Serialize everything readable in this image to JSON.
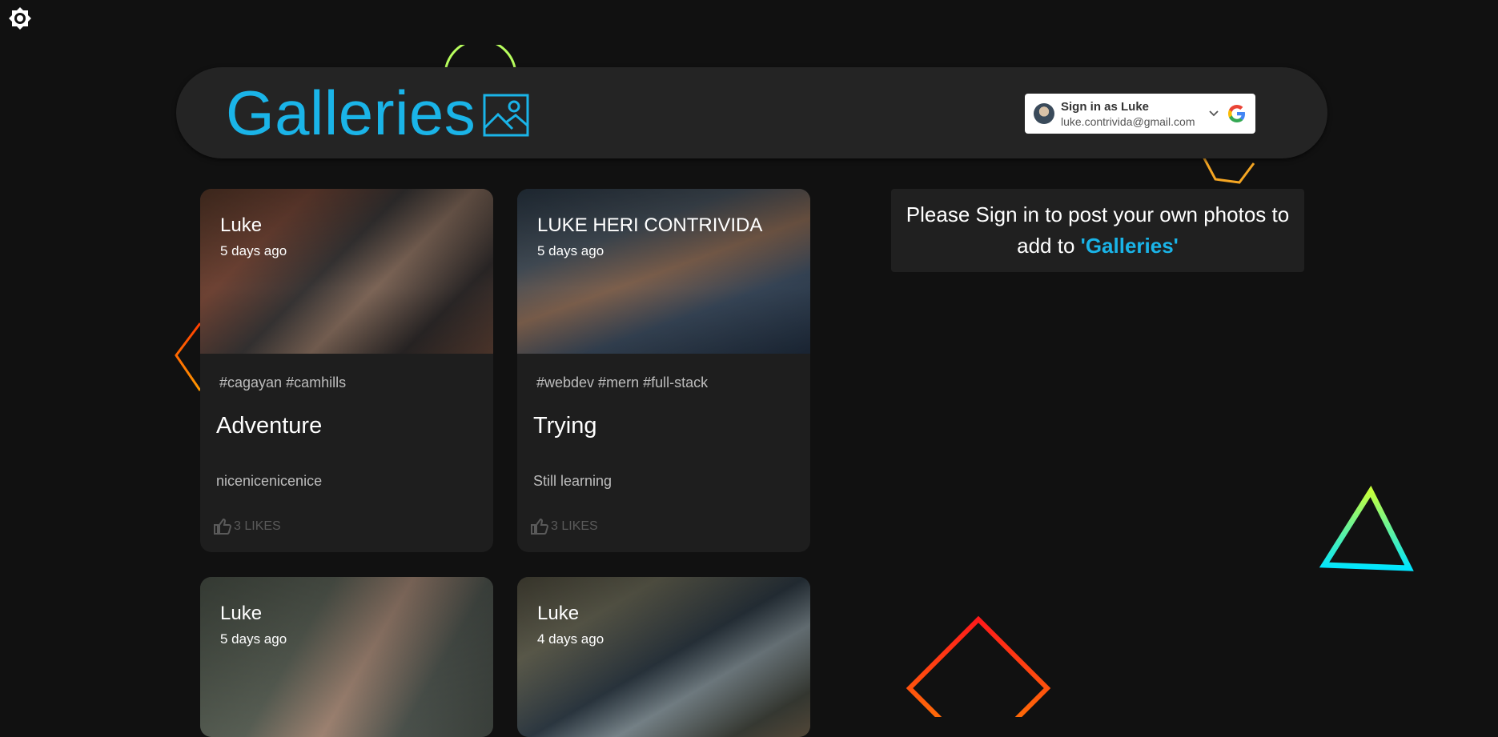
{
  "header": {
    "title": "Galleries",
    "signin": {
      "name": "Sign in as Luke",
      "email": "luke.contrivida@gmail.com"
    }
  },
  "posts": [
    {
      "owner": "Luke",
      "time": "5 days ago",
      "tags": "#cagayan #camhills",
      "title": "Adventure",
      "message": "nicenicenicenice",
      "likes": "3 LIKES"
    },
    {
      "owner": "LUKE HERI CONTRIVIDA",
      "time": "5 days ago",
      "tags": "#webdev #mern #full-stack",
      "title": "Trying",
      "message": "Still learning",
      "likes": "3 LIKES"
    },
    {
      "owner": "Luke",
      "time": "5 days ago"
    },
    {
      "owner": "Luke",
      "time": "4 days ago"
    }
  ],
  "notice": {
    "text_before": "Please Sign in to post your own photos to add to ",
    "highlight": "'Galleries'"
  },
  "colors": {
    "accent": "#1ab4e8",
    "background": "#111111",
    "card": "#1e1e1e"
  },
  "icons": [
    "brightness-icon",
    "image-icon",
    "chevron-down-icon",
    "google-icon",
    "thumb-up-icon"
  ]
}
